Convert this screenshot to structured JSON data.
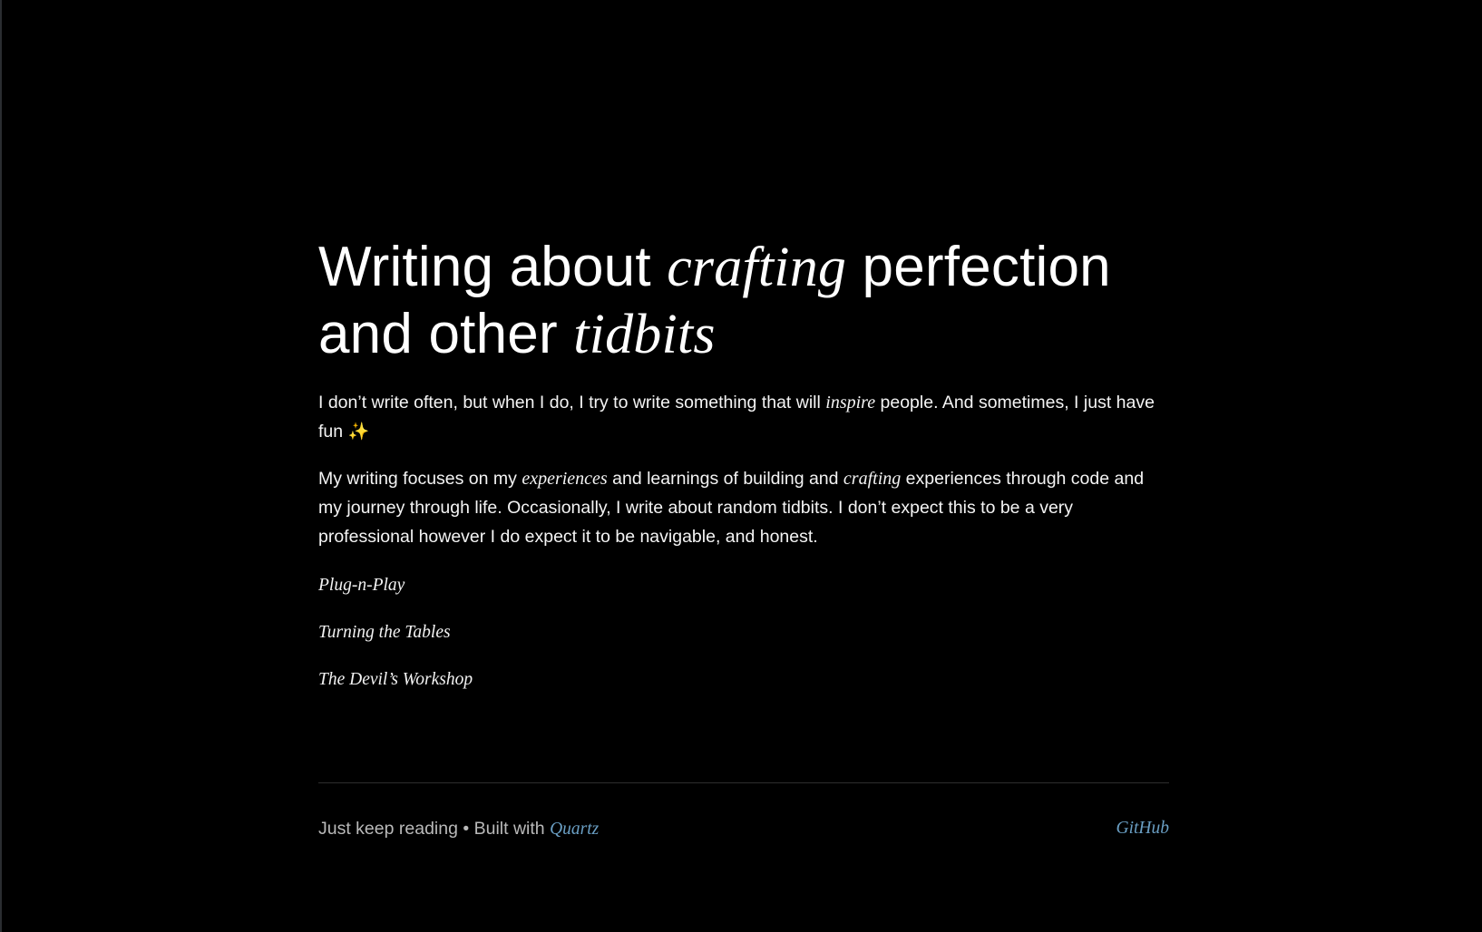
{
  "title": {
    "part1": "Writing about ",
    "em1": "crafting",
    "part2": " perfection and other ",
    "em2": "tidbits"
  },
  "intro": {
    "p1_a": "I don’t write often, but when I do, I try to write something that will ",
    "p1_em": "inspire",
    "p1_b": " people. And sometimes, I just have fun ",
    "p1_emoji": "✨",
    "p2_a": "My writing focuses on my ",
    "p2_em1": "experiences",
    "p2_b": " and learnings of building and ",
    "p2_em2": "crafting",
    "p2_c": " experiences through code and my journey through life. Occasionally, I write about random tidbits. I don’t expect this to be a very professional however I do expect it to be navigable, and honest."
  },
  "posts": [
    {
      "label": "Plug-n-Play"
    },
    {
      "label": "Turning the Tables"
    },
    {
      "label": "The Devil’s Workshop"
    }
  ],
  "footer": {
    "tagline": "Just keep reading",
    "separator": "•",
    "built_with": "Built with",
    "quartz_label": "Quartz",
    "github_label": "GitHub"
  },
  "colors": {
    "background": "#000000",
    "text": "#ffffff",
    "muted": "#b9b9b9",
    "link": "#6a9fc4",
    "sparkle": "#f6c343"
  }
}
